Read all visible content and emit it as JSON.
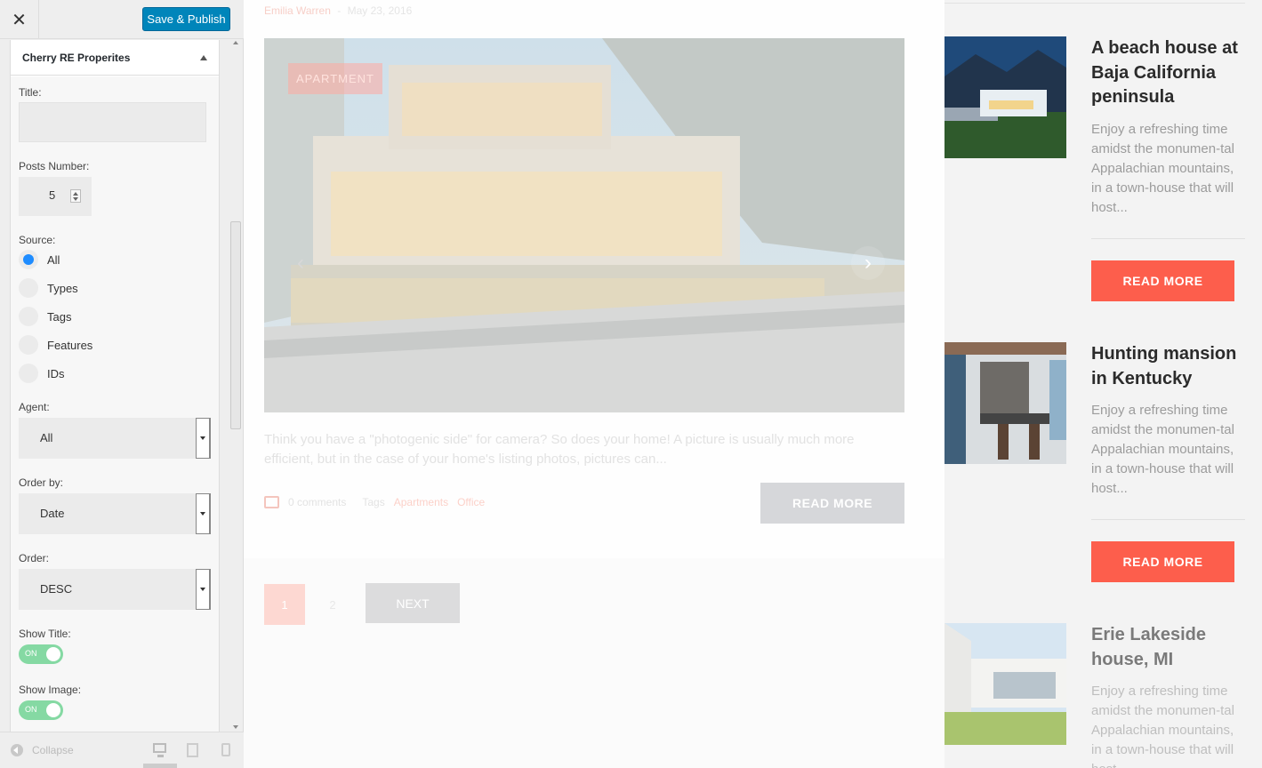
{
  "customizer": {
    "close_label": "✕",
    "publish_label": "Save & Publish",
    "section_title": "Cherry RE Properites",
    "fields": {
      "title_label": "Title:",
      "title_value": "",
      "posts_number_label": "Posts Number:",
      "posts_number_value": "5",
      "source_label": "Source:",
      "source_options": [
        "All",
        "Types",
        "Tags",
        "Features",
        "IDs"
      ],
      "source_selected": "All",
      "agent_label": "Agent:",
      "agent_value": "All",
      "order_by_label": "Order by:",
      "order_by_value": "Date",
      "order_label": "Order:",
      "order_value": "DESC",
      "show_title_label": "Show Title:",
      "show_title_value": "ON",
      "show_image_label": "Show Image:",
      "show_image_value": "ON"
    },
    "footer": {
      "collapse_label": "Collapse"
    }
  },
  "preview": {
    "post": {
      "author": "Emilia Warren",
      "separator": "-",
      "date": "May 23, 2016",
      "badge": "APARTMENT",
      "excerpt": "Think you have a \"photogenic side\" for camera? So does your home! A picture is usually much more efficient, but in the case of your home's listing photos, pictures can...",
      "comments": "0 comments",
      "tags_label": "Tags",
      "tags": [
        "Apartments",
        "Office"
      ],
      "read_more": "READ MORE"
    },
    "pagination": {
      "pages": [
        "1",
        "2"
      ],
      "current": "1",
      "next": "NEXT"
    },
    "sidebar_items": [
      {
        "title": "A beach house at Baja California peninsula",
        "excerpt": "Enjoy a refreshing time amidst the monumen-tal Appalachian mountains, in a town-house that will host...",
        "button": "READ MORE"
      },
      {
        "title": "Hunting mansion in Kentucky",
        "excerpt": "Enjoy a refreshing time amidst the monumen-tal Appalachian mountains, in a town-house that will host...",
        "button": "READ MORE"
      },
      {
        "title": "Erie Lakeside house, MI",
        "excerpt": "Enjoy a refreshing time amidst the monumen-tal Appalachian mountains, in a town-house that will host..."
      }
    ]
  },
  "colors": {
    "publish": "#0085ba",
    "accent": "#fd5e4c",
    "radio_checked": "#1e8cff",
    "toggle_on": "#85d9a3"
  }
}
